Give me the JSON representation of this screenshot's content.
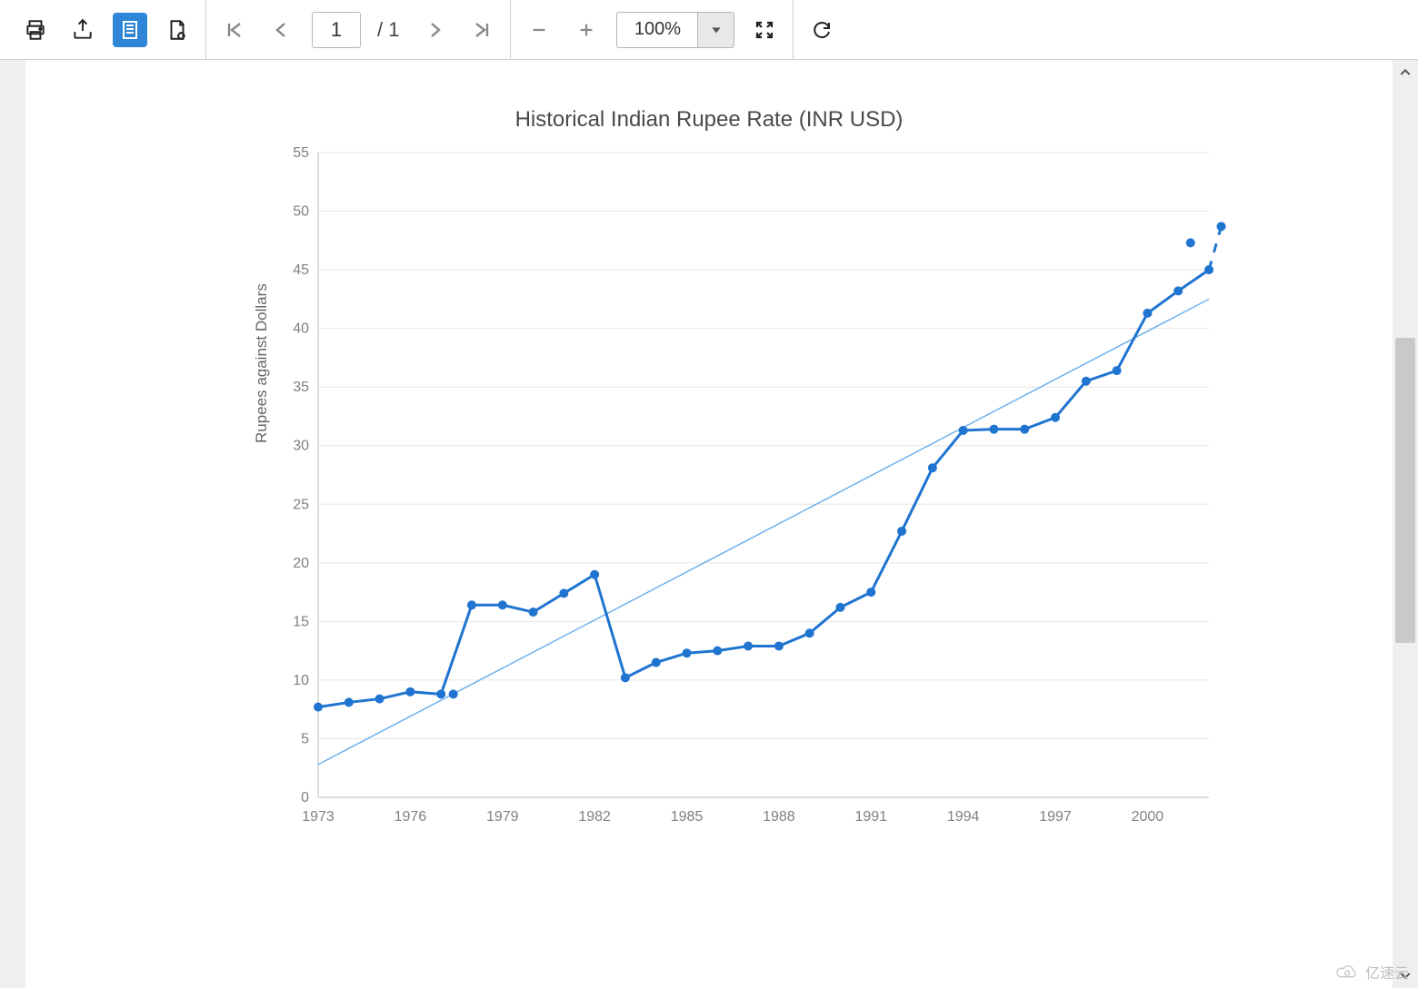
{
  "toolbar": {
    "page_current": "1",
    "page_total": "/ 1",
    "zoom": "100%"
  },
  "chart_data": {
    "type": "line",
    "title": "Historical Indian Rupee Rate (INR USD)",
    "ylabel": "Rupees against Dollars",
    "xlabel": "",
    "ylim": [
      0,
      55
    ],
    "xlim": [
      1973,
      2002
    ],
    "y_ticks": [
      0,
      5,
      10,
      15,
      20,
      25,
      30,
      35,
      40,
      45,
      50,
      55
    ],
    "x_ticks": [
      1973,
      1976,
      1979,
      1982,
      1985,
      1988,
      1991,
      1994,
      1997,
      2000
    ],
    "x": [
      1973,
      1974,
      1975,
      1976,
      1977,
      1978,
      1979,
      1980,
      1981,
      1982,
      1983,
      1984,
      1985,
      1986,
      1987,
      1988,
      1989,
      1990,
      1991,
      1992,
      1993,
      1994,
      1995,
      1996,
      1997,
      1998,
      1999,
      2000,
      2001,
      2002
    ],
    "values": [
      7.7,
      8.1,
      8.4,
      9.0,
      8.8,
      16.4,
      16.4,
      15.8,
      17.4,
      19.0,
      10.2,
      11.5,
      12.3,
      12.5,
      12.9,
      12.9,
      14.0,
      16.2,
      17.5,
      22.7,
      28.1,
      31.3,
      31.4,
      31.4,
      32.4,
      35.5,
      36.4,
      41.3,
      43.2,
      45.0
    ],
    "trendline": {
      "x1": 1973,
      "y1": 2.8,
      "x2": 2002,
      "y2": 42.5
    },
    "extra_points": [
      {
        "x": 1977.4,
        "y": 8.8
      },
      {
        "x": 2001.4,
        "y": 47.3
      },
      {
        "x": 2002.4,
        "y": 48.7
      }
    ]
  },
  "watermark": {
    "text": "亿速云"
  }
}
